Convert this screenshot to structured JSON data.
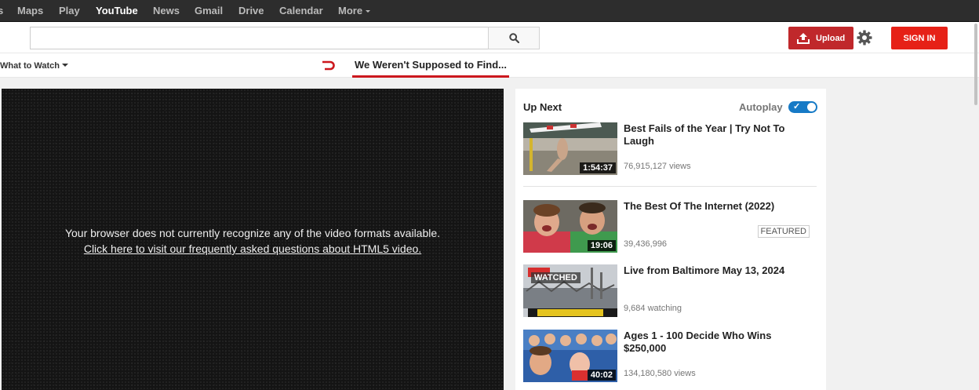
{
  "gbar": {
    "items": [
      "s",
      "Maps",
      "Play",
      "YouTube",
      "News",
      "Gmail",
      "Drive",
      "Calendar",
      "More"
    ],
    "active": "YouTube"
  },
  "masthead": {
    "search_placeholder": "",
    "upload_label": "Upload",
    "signin_label": "SIGN IN"
  },
  "subnav": {
    "what_to_watch": "What to Watch",
    "now_playing_title": "We Weren't Supposed to Find..."
  },
  "player": {
    "message": "Your browser does not currently recognize any of the video formats available.",
    "link_text": "Click here to visit our frequently asked questions about HTML5 video."
  },
  "sidebar": {
    "up_next_label": "Up Next",
    "autoplay_label": "Autoplay",
    "autoplay_on": true,
    "videos": [
      {
        "title": "Best Fails of the Year | Try Not To Laugh",
        "meta": "76,915,127 views",
        "duration": "1:54:37",
        "badge": "",
        "watched": ""
      },
      {
        "title": "The Best Of The Internet (2022)",
        "meta": "39,436,996",
        "duration": "19:06",
        "badge": "FEATURED",
        "watched": ""
      },
      {
        "title": "Live from Baltimore May 13, 2024",
        "meta": "9,684 watching",
        "duration": "",
        "badge": "",
        "watched": "WATCHED"
      },
      {
        "title": "Ages 1 - 100 Decide Who Wins $250,000",
        "meta": "134,180,580 views",
        "duration": "40:02",
        "badge": "",
        "watched": ""
      }
    ]
  },
  "colors": {
    "brand_red": "#e62117",
    "upload_red": "#c0282b",
    "autoplay_blue": "#167ac6",
    "gbar_bg": "#2d2d2d"
  }
}
